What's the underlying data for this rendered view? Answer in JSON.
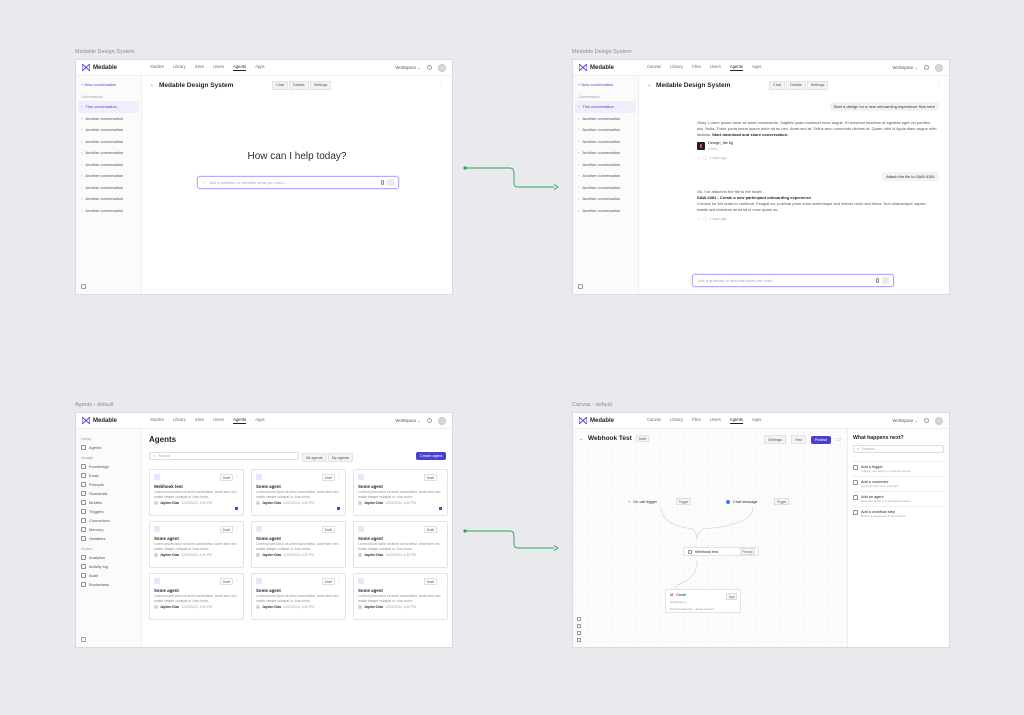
{
  "frames": [
    {
      "label": "Medable Design System"
    },
    {
      "label": "Medable Design System"
    },
    {
      "label": "Agents - default"
    },
    {
      "label": "Canvas - default"
    }
  ],
  "brand": {
    "name": "Medable",
    "accent": "#4b3fd1"
  },
  "nav": {
    "links": [
      "Studies",
      "Library",
      "Sites",
      "Users",
      "Agents",
      "Apps"
    ],
    "links_alt": [
      "Canvas",
      "Library",
      "Files",
      "Users",
      "Agents",
      "Apps"
    ],
    "active": "Agents",
    "workspace": "Workspace"
  },
  "chat": {
    "new_label": "+ New conversation",
    "section": "Conversations",
    "active_item": "This conversation",
    "items": [
      "Another conversation",
      "Another conversation",
      "Another conversation",
      "Another conversation",
      "Another conversation",
      "Another conversation",
      "Another conversation",
      "Another conversation",
      "Another conversation"
    ],
    "title": "Medable Design System",
    "tabs": [
      "Chat",
      "Details",
      "Settings"
    ],
    "hero": "How can I help today?",
    "placeholder": "Ask a question or describe what you need..."
  },
  "thread": {
    "user1": "Start a design for a new onboarding experience flow here",
    "bot1": "Okay. Lorem ipsum dolor sit amet consectetur. Sagittis quam euismod nunc augue. Et euismod faucibus at egestas eget vel porttitor nisl. Nulla. Tortor porta lorem ipsum dolor sit ac nec. Amet sed at. Tellus arcu commodo ultrices et. Quam nibh id ligula diam augue nibh facilisis.",
    "bot1_bold": "Start download and share conversation.",
    "file_name": "Design_file.fig",
    "file_meta": "2.4mb",
    "time1": "2 days ago",
    "user2": "Attach the file to SAW-4381",
    "bot2_intro": "Ok. I've attached the file to the ticket:",
    "bot2_title": "SAW-4381 - Create a new participant onboarding experience",
    "bot2_body": "Curious for full scale to continue. Feugiat eu, pulvinar proin enim scelerisque sed enimer dolor sed tellus. Non ullamcorper sapien mattis sed interdum amet sit in nunc quam ac.",
    "time2": "2 days ago",
    "placeholder": "Ask a question or describe what you need..."
  },
  "agents": {
    "title": "Agents",
    "sidebar_sections": [
      {
        "name": "Library",
        "items": [
          "Agents"
        ]
      },
      {
        "name": "Manage",
        "items": [
          "Knowledge",
          "Evals",
          "Prompts",
          "Guardrails",
          "Models",
          "Triggers",
          "Connectors",
          "Memory",
          "Variables"
        ]
      },
      {
        "name": "Monitor",
        "items": [
          "Analytics",
          "Activity log",
          "Audit",
          "Bookmarks"
        ]
      }
    ],
    "search_placeholder": "Search",
    "filters": [
      "All agents",
      "My agents"
    ],
    "create_label": "Create agent",
    "cards": [
      {
        "title": "Webhook test",
        "status": "Draft",
        "desc": "Lorem ipsum dolor sit amet consectetur. Amet sem nec mattis integer volutpat in. Arcu tortor.",
        "author": "Jayden Dias",
        "date": "12/22/2024, 4:30 PM"
      },
      {
        "title": "Some agent",
        "status": "Draft",
        "desc": "Lorem ipsum dolor sit amet consectetur. Amet sem nec mattis integer volutpat in. Arcu tortor.",
        "author": "Jayden Dias",
        "date": "12/22/2024, 4:30 PM"
      },
      {
        "title": "Some agent",
        "status": "Draft",
        "desc": "Lorem ipsum dolor sit amet consectetur. Amet sem nec mattis integer volutpat in. Arcu tortor.",
        "author": "Jayden Dias",
        "date": "12/22/2024, 4:30 PM"
      },
      {
        "title": "Some agent",
        "status": "Draft",
        "desc": "Lorem ipsum dolor sit amet consectetur. Amet sem nec mattis integer volutpat in. Arcu tortor.",
        "author": "Jayden Dias",
        "date": "12/22/2024, 4:30 PM"
      },
      {
        "title": "Some agent",
        "status": "Draft",
        "desc": "Lorem ipsum dolor sit amet consectetur. Amet sem nec mattis integer volutpat in. Arcu tortor.",
        "author": "Jayden Dias",
        "date": "12/22/2024, 4:30 PM"
      },
      {
        "title": "Some agent",
        "status": "Draft",
        "desc": "Lorem ipsum dolor sit amet consectetur. Amet sem nec mattis integer volutpat in. Arcu tortor.",
        "author": "Jayden Dias",
        "date": "12/22/2024, 4:30 PM"
      },
      {
        "title": "Some agent",
        "status": "Draft",
        "desc": "Lorem ipsum dolor sit amet consectetur. Amet sem nec mattis integer volutpat in. Arcu tortor.",
        "author": "Jayden Dias",
        "date": "12/22/2024, 4:30 PM"
      },
      {
        "title": "Some agent",
        "status": "Draft",
        "desc": "Lorem ipsum dolor sit amet consectetur. Amet sem nec mattis integer volutpat in. Arcu tortor.",
        "author": "Jayden Dias",
        "date": "12/22/2024, 4:30 PM"
      },
      {
        "title": "Some agent",
        "status": "Draft",
        "desc": "Lorem ipsum dolor sit amet consectetur. Amet sem nec mattis integer volutpat in. Arcu tortor.",
        "author": "Jayden Dias",
        "date": "12/22/2024, 4:30 PM"
      }
    ]
  },
  "canvas": {
    "title": "Webhook Test",
    "status": "Draft",
    "actions": [
      "Settings",
      "Test",
      "Publish"
    ],
    "nodes": {
      "trigger_a": "On call trigger",
      "trigger_a_tag": "Trigger",
      "trigger_b": "Chat message",
      "trigger_b_tag": "Trigger",
      "webhook": "Webhook test",
      "webhook_tag": "Prompt",
      "gmail": "Gmail",
      "gmail_tag": "App",
      "gmail_desc": "Reference a",
      "gmail_meta": "Prompt response · Some content"
    },
    "panel": {
      "title": "What happens next?",
      "search": "Search...",
      "items": [
        {
          "title": "Add a trigger",
          "desc": "Trigger your agent on specific events"
        },
        {
          "title": "Add a connector",
          "desc": "Connect with tools and apps"
        },
        {
          "title": "Add an agent",
          "desc": "Delegate tasks to a specialized agent"
        },
        {
          "title": "Add a workflow step",
          "desc": "Define a sequence of instructions"
        }
      ]
    }
  }
}
